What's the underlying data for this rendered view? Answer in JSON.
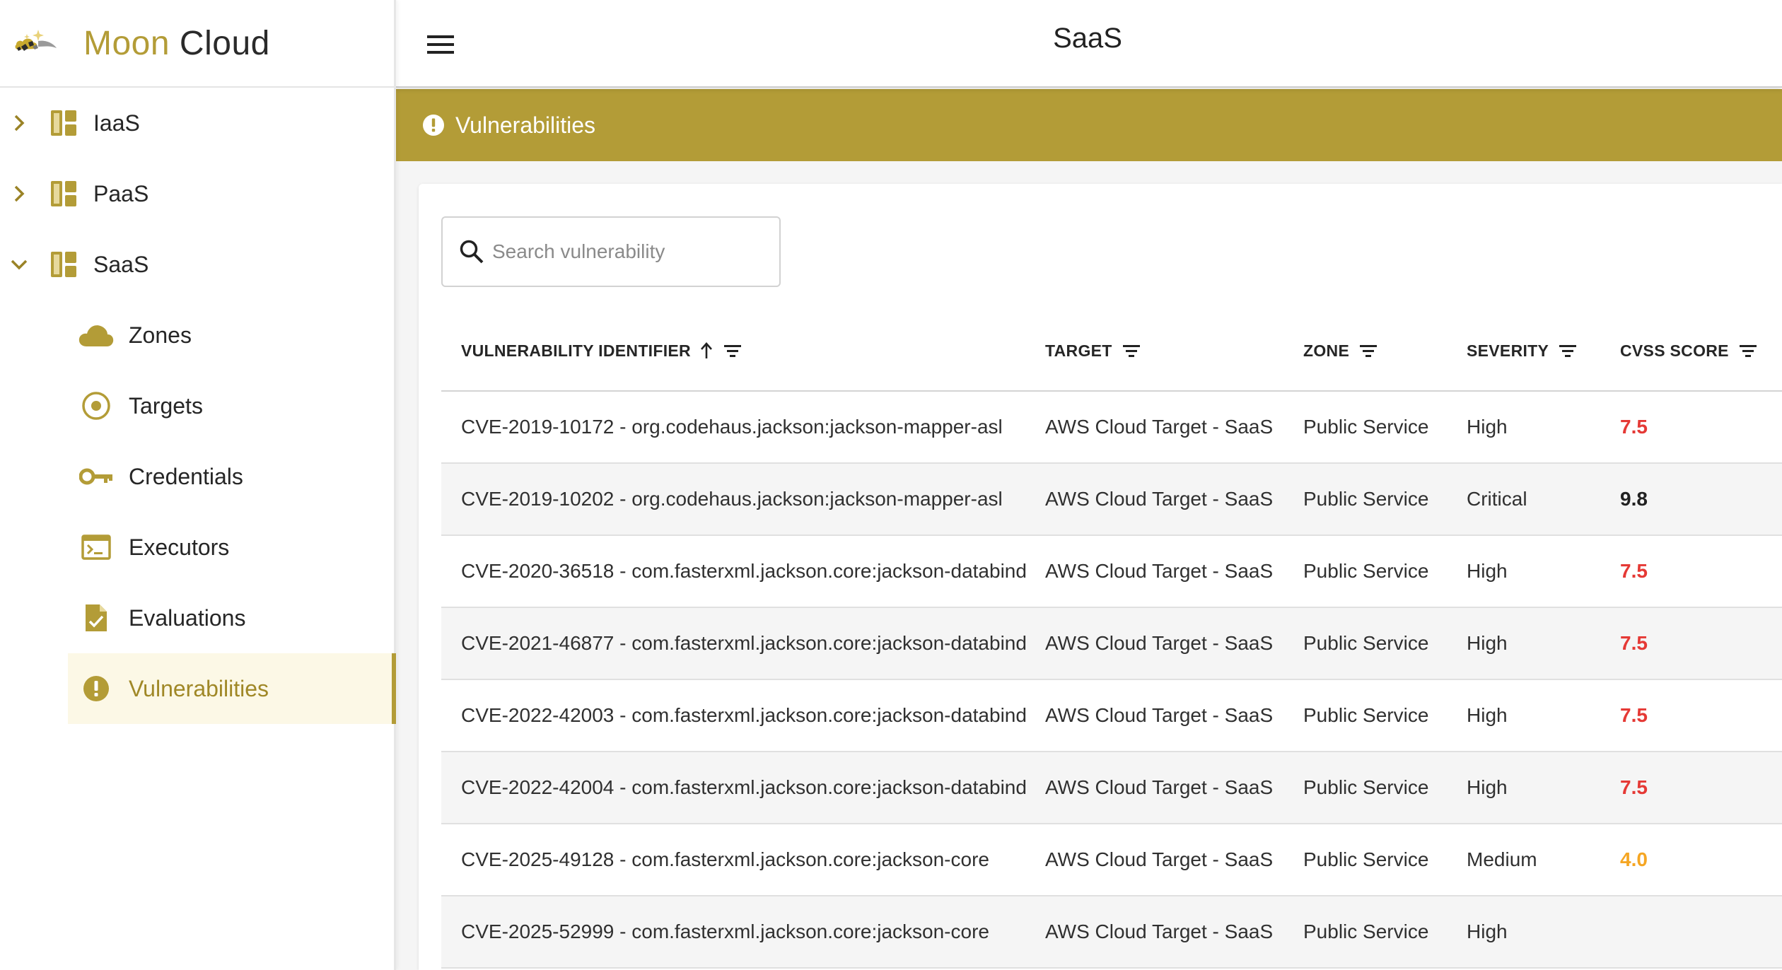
{
  "brand": {
    "name_part1": "Moon",
    "name_part2": "Cloud",
    "logo_icon": "moon-cloud-logo-icon"
  },
  "colors": {
    "accent": "#b39c37",
    "active_bg": "#fcf8e6",
    "high": "#e53935",
    "critical": "#212121",
    "medium": "#f5a623"
  },
  "sidebar": {
    "groups": [
      {
        "label": "IaaS",
        "expanded": false
      },
      {
        "label": "PaaS",
        "expanded": false
      },
      {
        "label": "SaaS",
        "expanded": true
      }
    ],
    "items": [
      {
        "label": "Zones",
        "icon": "cloud-icon"
      },
      {
        "label": "Targets",
        "icon": "target-icon"
      },
      {
        "label": "Credentials",
        "icon": "key-icon"
      },
      {
        "label": "Executors",
        "icon": "terminal-icon"
      },
      {
        "label": "Evaluations",
        "icon": "document-check-icon"
      },
      {
        "label": "Vulnerabilities",
        "icon": "alert-circle-icon",
        "active": true
      }
    ]
  },
  "header": {
    "title": "SaaS"
  },
  "section": {
    "title": "Vulnerabilities"
  },
  "search": {
    "placeholder": "Search vulnerability",
    "value": ""
  },
  "table": {
    "columns": [
      {
        "label": "VULNERABILITY IDENTIFIER",
        "sorted": "ascending"
      },
      {
        "label": "TARGET"
      },
      {
        "label": "ZONE"
      },
      {
        "label": "SEVERITY"
      },
      {
        "label": "CVSS SCORE"
      }
    ],
    "rows": [
      {
        "id": "CVE-2019-10172 - org.codehaus.jackson:jackson-mapper-asl",
        "target": "AWS Cloud Target - SaaS",
        "zone": "Public Service",
        "severity": "High",
        "score": "7.5"
      },
      {
        "id": "CVE-2019-10202 - org.codehaus.jackson:jackson-mapper-asl",
        "target": "AWS Cloud Target - SaaS",
        "zone": "Public Service",
        "severity": "Critical",
        "score": "9.8"
      },
      {
        "id": "CVE-2020-36518 - com.fasterxml.jackson.core:jackson-databind",
        "target": "AWS Cloud Target - SaaS",
        "zone": "Public Service",
        "severity": "High",
        "score": "7.5"
      },
      {
        "id": "CVE-2021-46877 - com.fasterxml.jackson.core:jackson-databind",
        "target": "AWS Cloud Target - SaaS",
        "zone": "Public Service",
        "severity": "High",
        "score": "7.5"
      },
      {
        "id": "CVE-2022-42003 - com.fasterxml.jackson.core:jackson-databind",
        "target": "AWS Cloud Target - SaaS",
        "zone": "Public Service",
        "severity": "High",
        "score": "7.5"
      },
      {
        "id": "CVE-2022-42004 - com.fasterxml.jackson.core:jackson-databind",
        "target": "AWS Cloud Target - SaaS",
        "zone": "Public Service",
        "severity": "High",
        "score": "7.5"
      },
      {
        "id": "CVE-2025-49128 - com.fasterxml.jackson.core:jackson-core",
        "target": "AWS Cloud Target - SaaS",
        "zone": "Public Service",
        "severity": "Medium",
        "score": "4.0"
      },
      {
        "id": "CVE-2025-52999 - com.fasterxml.jackson.core:jackson-core",
        "target": "AWS Cloud Target - SaaS",
        "zone": "Public Service",
        "severity": "High",
        "score": ""
      }
    ]
  }
}
